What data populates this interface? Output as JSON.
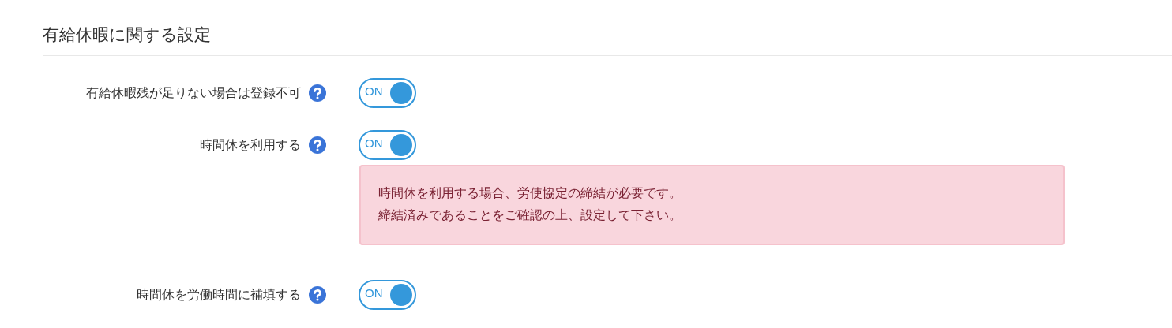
{
  "section": {
    "title": "有給休暇に関する設定"
  },
  "settings": [
    {
      "label": "有給休暇残が足りない場合は登録不可",
      "toggle": {
        "text": "ON",
        "on": true
      }
    },
    {
      "label": "時間休を利用する",
      "toggle": {
        "text": "ON",
        "on": true
      },
      "alert": {
        "lines": [
          "時間休を利用する場合、労使協定の締結が必要です。",
          "締結済みであることをご確認の上、設定して下さい。"
        ]
      }
    },
    {
      "label": "時間休を労働時間に補填する",
      "toggle": {
        "text": "ON",
        "on": true
      }
    }
  ]
}
